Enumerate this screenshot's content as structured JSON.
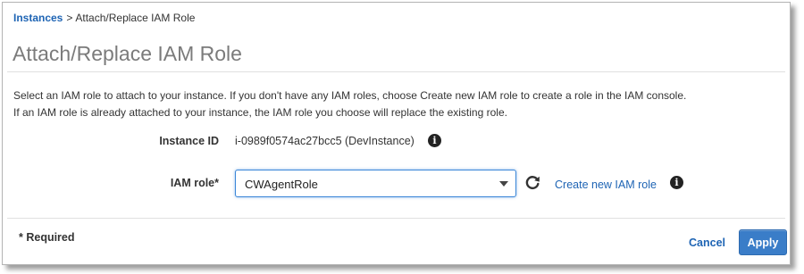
{
  "breadcrumb": {
    "parent": "Instances",
    "separator": ">",
    "current": "Attach/Replace IAM Role"
  },
  "page": {
    "title": "Attach/Replace IAM Role",
    "description_line1": "Select an IAM role to attach to your instance. If you don't have any IAM roles, choose Create new IAM role to create a role in the IAM console.",
    "description_line2": "If an IAM role is already attached to your instance, the IAM role you choose will replace the existing role."
  },
  "form": {
    "instance_id_label": "Instance ID",
    "instance_id_value": "i-0989f0574ac27bcc5 (DevInstance)",
    "iam_role_label": "IAM role*",
    "iam_role_value": "CWAgentRole",
    "create_link": "Create new IAM role",
    "info_icon": "i"
  },
  "footer": {
    "required_note": "* Required",
    "cancel_label": "Cancel",
    "apply_label": "Apply"
  },
  "icons": {
    "info": "info-icon",
    "refresh": "refresh-icon",
    "dropdown": "chevron-down-icon"
  },
  "colors": {
    "link": "#1e64b4",
    "title": "#7b7b7b",
    "primary_button": "#3a7dc8",
    "focus_border": "#3b86d8"
  }
}
